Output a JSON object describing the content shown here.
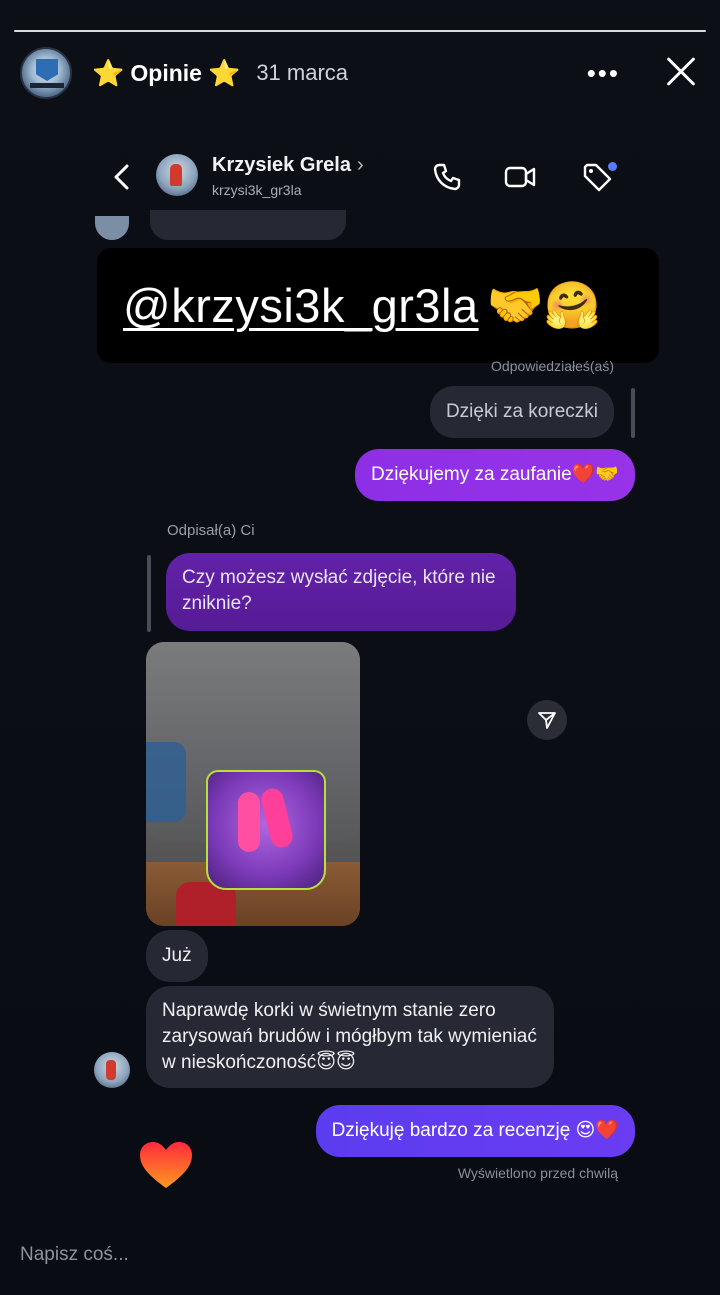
{
  "story": {
    "title": "Opinie",
    "star": "⭐",
    "date": "31 marca",
    "more": "•••"
  },
  "dm": {
    "name": "Krzysiek Grela",
    "name_chevron": "›",
    "handle": "krzysi3k_gr3la"
  },
  "mention": {
    "text": "@krzysi3k_gr3la",
    "emoji": "🤝🤗"
  },
  "messages": {
    "replied_label": "Odpowiedziałeś(aś)",
    "reply_quote": "Dzięki za koreczki",
    "sent_thanks": "Dziękujemy za zaufanie❤️🤝",
    "received_label": "Odpisał(a) Ci",
    "quote_received": "Czy możesz wysłać zdjęcie, które nie zniknie?",
    "juz": "Już",
    "review": "Naprawdę korki w świetnym stanie zero zarysowań brudów i mógłbym tak wymieniać w nieskończoność😇😇",
    "sent_review_thanks": "Dziękuję bardzo za recenzję 😍❤️",
    "seen": "Wyświetlono przed chwilą"
  },
  "reply": {
    "placeholder": "Napisz coś..."
  }
}
